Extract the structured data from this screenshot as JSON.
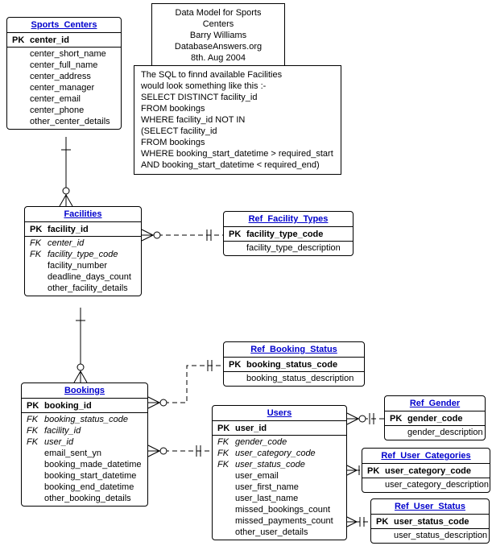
{
  "meta_box": {
    "line1": "Data Model for Sports Centers",
    "line2": "Barry Williams",
    "line3": "DatabaseAnswers.org",
    "line4": "8th. Aug 2004"
  },
  "sql_box": {
    "l1": "The SQL to finnd available Facilities",
    "l2": "would look something like this  :-",
    "l3": "SELECT DISTINCT facility_id",
    "l4": "FROM bookings",
    "l5": "WHERE facility_id NOT IN",
    "l6": "(SELECT facility_id",
    "l7": "FROM bookings",
    "l8": "WHERE booking_start_datetime > required_start",
    "l9": " AND     booking_start_datetime < required_end)"
  },
  "entities": {
    "sports_centers": {
      "title": "Sports_Centers",
      "cols": [
        {
          "key": "PK",
          "name": "center_id",
          "pk": true
        },
        {
          "sep": true
        },
        {
          "key": "",
          "name": "center_short_name"
        },
        {
          "key": "",
          "name": "center_full_name"
        },
        {
          "key": "",
          "name": "center_address"
        },
        {
          "key": "",
          "name": "center_manager"
        },
        {
          "key": "",
          "name": "center_email"
        },
        {
          "key": "",
          "name": "center_phone"
        },
        {
          "key": "",
          "name": "other_center_details"
        }
      ]
    },
    "facilities": {
      "title": "Facilities",
      "cols": [
        {
          "key": "PK",
          "name": "facility_id",
          "pk": true
        },
        {
          "sep": true
        },
        {
          "key": "FK",
          "name": "center_id",
          "fk": true
        },
        {
          "key": "FK",
          "name": "facility_type_code",
          "fk": true
        },
        {
          "key": "",
          "name": "facility_number"
        },
        {
          "key": "",
          "name": "deadline_days_count"
        },
        {
          "key": "",
          "name": "other_facility_details"
        }
      ]
    },
    "ref_facility_types": {
      "title": "Ref_Facility_Types",
      "cols": [
        {
          "key": "PK",
          "name": "facility_type_code",
          "pk": true
        },
        {
          "sep": true
        },
        {
          "key": "",
          "name": "facility_type_description"
        }
      ]
    },
    "ref_booking_status": {
      "title": "Ref_Booking_Status",
      "cols": [
        {
          "key": "PK",
          "name": "booking_status_code",
          "pk": true
        },
        {
          "sep": true
        },
        {
          "key": "",
          "name": "booking_status_description"
        }
      ]
    },
    "bookings": {
      "title": "Bookings",
      "cols": [
        {
          "key": "PK",
          "name": "booking_id",
          "pk": true
        },
        {
          "sep": true
        },
        {
          "key": "FK",
          "name": "booking_status_code",
          "fk": true
        },
        {
          "key": "FK",
          "name": "facility_id",
          "fk": true
        },
        {
          "key": "FK",
          "name": "user_id",
          "fk": true
        },
        {
          "key": "",
          "name": "email_sent_yn"
        },
        {
          "key": "",
          "name": "booking_made_datetime"
        },
        {
          "key": "",
          "name": "booking_start_datetime"
        },
        {
          "key": "",
          "name": "booking_end_datetime"
        },
        {
          "key": "",
          "name": "other_booking_details"
        }
      ]
    },
    "users": {
      "title": "Users",
      "cols": [
        {
          "key": "PK",
          "name": "user_id",
          "pk": true
        },
        {
          "sep": true
        },
        {
          "key": "FK",
          "name": "gender_code",
          "fk": true
        },
        {
          "key": "FK",
          "name": "user_category_code",
          "fk": true
        },
        {
          "key": "FK",
          "name": "user_status_code",
          "fk": true
        },
        {
          "key": "",
          "name": "user_email"
        },
        {
          "key": "",
          "name": "user_first_name"
        },
        {
          "key": "",
          "name": "user_last_name"
        },
        {
          "key": "",
          "name": "missed_bookings_count"
        },
        {
          "key": "",
          "name": "missed_payments_count"
        },
        {
          "key": "",
          "name": "other_user_details"
        }
      ]
    },
    "ref_gender": {
      "title": "Ref_Gender",
      "cols": [
        {
          "key": "PK",
          "name": "gender_code",
          "pk": true
        },
        {
          "sep": true
        },
        {
          "key": "",
          "name": "gender_description"
        }
      ]
    },
    "ref_user_categories": {
      "title": "Ref_User_Categories",
      "cols": [
        {
          "key": "PK",
          "name": "user_category_code",
          "pk": true
        },
        {
          "sep": true
        },
        {
          "key": "",
          "name": "user_category_description"
        }
      ]
    },
    "ref_user_status": {
      "title": "Ref_User_Status",
      "cols": [
        {
          "key": "PK",
          "name": "user_status_code",
          "pk": true
        },
        {
          "sep": true
        },
        {
          "key": "",
          "name": "user_status_description"
        }
      ]
    }
  },
  "chart_data": {
    "type": "erd",
    "entities": [
      "Sports_Centers",
      "Facilities",
      "Ref_Facility_Types",
      "Ref_Booking_Status",
      "Bookings",
      "Users",
      "Ref_Gender",
      "Ref_User_Categories",
      "Ref_User_Status"
    ],
    "relationships": [
      {
        "from": "Sports_Centers",
        "to": "Facilities",
        "style": "solid",
        "card_from": "one",
        "card_to": "many"
      },
      {
        "from": "Facilities",
        "to": "Ref_Facility_Types",
        "style": "dashed",
        "card_from": "many",
        "card_to": "one"
      },
      {
        "from": "Facilities",
        "to": "Bookings",
        "style": "solid",
        "card_from": "one",
        "card_to": "many"
      },
      {
        "from": "Bookings",
        "to": "Ref_Booking_Status",
        "style": "dashed",
        "card_from": "many",
        "card_to": "one"
      },
      {
        "from": "Bookings",
        "to": "Users",
        "style": "dashed",
        "card_from": "many",
        "card_to": "one"
      },
      {
        "from": "Users",
        "to": "Ref_Gender",
        "style": "dashed",
        "card_from": "many",
        "card_to": "one"
      },
      {
        "from": "Users",
        "to": "Ref_User_Categories",
        "style": "dashed",
        "card_from": "many",
        "card_to": "one"
      },
      {
        "from": "Users",
        "to": "Ref_User_Status",
        "style": "dashed",
        "card_from": "many",
        "card_to": "one"
      }
    ]
  }
}
